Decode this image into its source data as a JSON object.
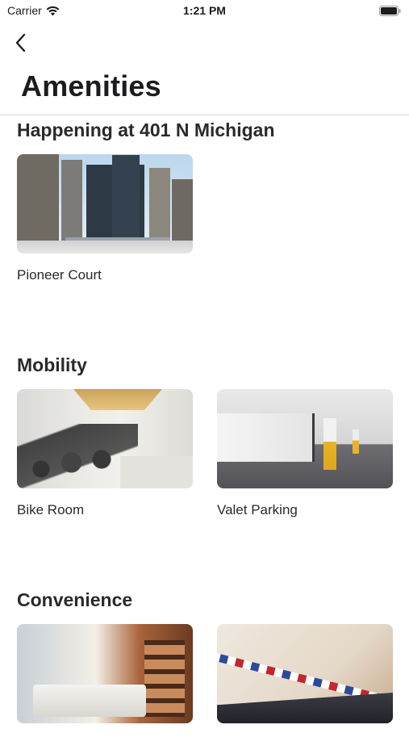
{
  "status_bar": {
    "carrier": "Carrier",
    "time": "1:21 PM",
    "wifi_icon": "wifi-icon",
    "battery_icon": "battery-icon"
  },
  "nav": {
    "back_icon": "chevron-left-icon"
  },
  "page": {
    "title": "Amenities"
  },
  "sections": [
    {
      "title": "Happening at 401 N Michigan",
      "cards": [
        {
          "label": "Pioneer Court",
          "image": "plaza-with-skyscrapers"
        }
      ]
    },
    {
      "title": "Mobility",
      "cards": [
        {
          "label": "Bike Room",
          "image": "indoor-bike-racks"
        },
        {
          "label": "Valet Parking",
          "image": "parking-garage"
        }
      ]
    },
    {
      "title": "Convenience",
      "cards": [
        {
          "label": "",
          "image": "cafe-deli-counter"
        },
        {
          "label": "",
          "image": "airmail-envelope"
        }
      ]
    }
  ]
}
